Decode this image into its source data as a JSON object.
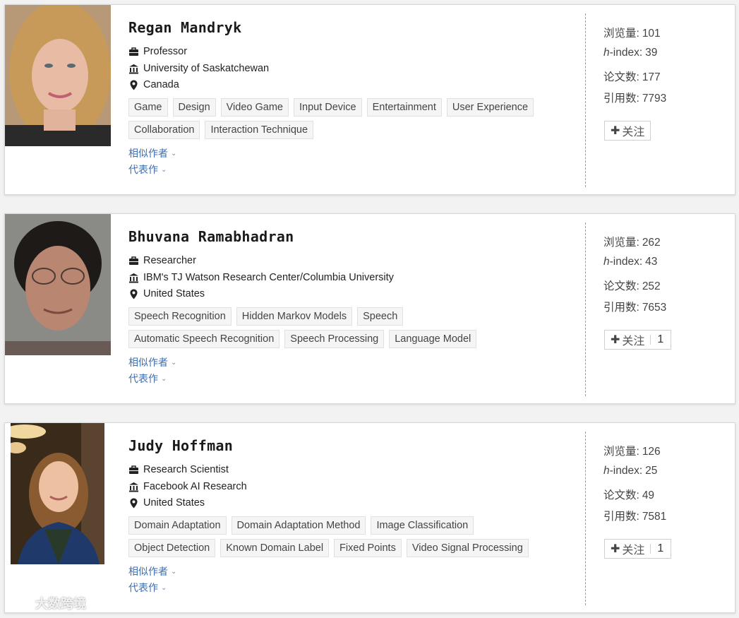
{
  "cards": [
    {
      "name": "Regan Mandryk",
      "position": "Professor",
      "affiliation": "University of Saskatchewan",
      "country": "Canada",
      "tags": [
        [
          "Game",
          "Design",
          "Video Game",
          "Input Device",
          "Entertainment",
          "User Experience"
        ],
        [
          "Collaboration",
          "Interaction Technique"
        ]
      ],
      "similar_label": "相似作者",
      "works_label": "代表作",
      "stats": {
        "views_label": "浏览量:",
        "views": "101",
        "h_label": "h",
        "h_suffix": "-index:",
        "h": "39",
        "papers_label": "论文数:",
        "papers": "177",
        "citations_label": "引用数:",
        "citations": "7793"
      },
      "follow_label": "关注",
      "follow_count": ""
    },
    {
      "name": "Bhuvana Ramabhadran",
      "position": "Researcher",
      "affiliation": "IBM's TJ Watson Research Center/Columbia University",
      "country": "United States",
      "tags": [
        [
          "Speech Recognition",
          "Hidden Markov Models",
          "Speech"
        ],
        [
          "Automatic Speech Recognition",
          "Speech Processing",
          "Language Model"
        ]
      ],
      "similar_label": "相似作者",
      "works_label": "代表作",
      "stats": {
        "views_label": "浏览量:",
        "views": "262",
        "h_label": "h",
        "h_suffix": "-index:",
        "h": "43",
        "papers_label": "论文数:",
        "papers": "252",
        "citations_label": "引用数:",
        "citations": "7653"
      },
      "follow_label": "关注",
      "follow_count": "1"
    },
    {
      "name": "Judy Hoffman",
      "position": "Research Scientist",
      "affiliation": "Facebook AI Research",
      "country": "United States",
      "tags": [
        [
          "Domain Adaptation",
          "Domain Adaptation Method",
          "Image Classification"
        ],
        [
          "Object Detection",
          "Known Domain Label",
          "Fixed Points",
          "Video Signal Processing"
        ]
      ],
      "similar_label": "相似作者",
      "works_label": "代表作",
      "stats": {
        "views_label": "浏览量:",
        "views": "126",
        "h_label": "h",
        "h_suffix": "-index:",
        "h": "25",
        "papers_label": "论文数:",
        "papers": "49",
        "citations_label": "引用数:",
        "citations": "7581"
      },
      "follow_label": "关注",
      "follow_count": "1"
    }
  ],
  "watermark": "大数跨境",
  "icons": {
    "position": "briefcase-icon",
    "affiliation": "institution-icon",
    "country": "location-pin-icon"
  }
}
